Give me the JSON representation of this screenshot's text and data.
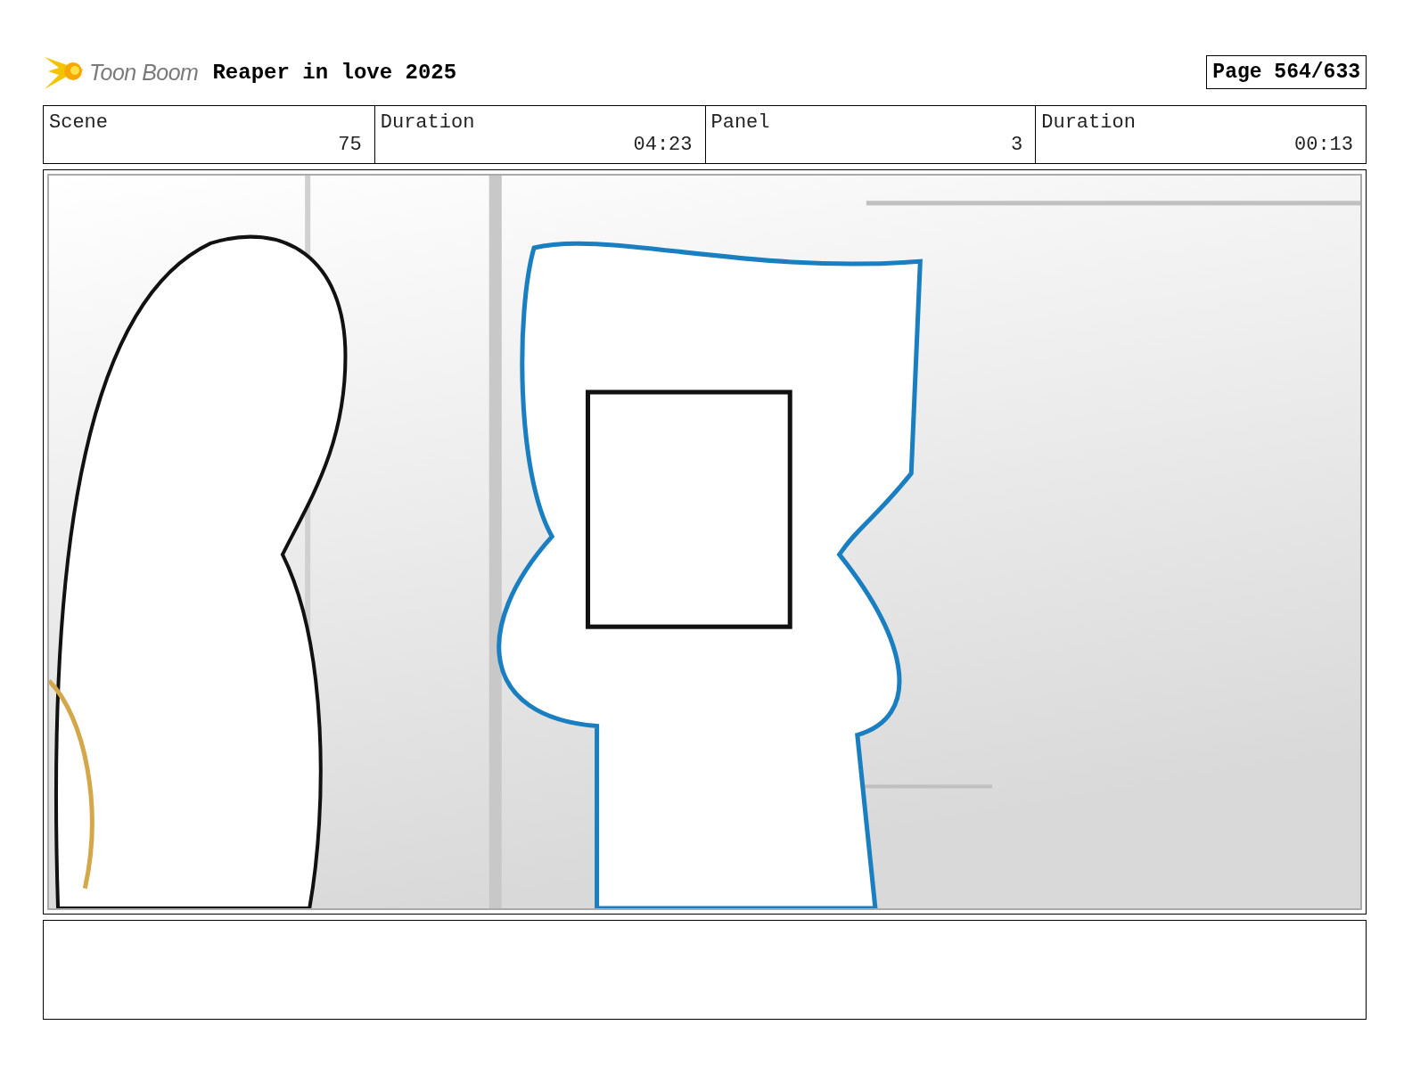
{
  "header": {
    "logo": "Toon Boom",
    "title": "Reaper in love 2025",
    "page": "Page 564/633"
  },
  "info": [
    {
      "label": "Scene",
      "value": "75"
    },
    {
      "label": "Duration",
      "value": "04:23"
    },
    {
      "label": "Panel",
      "value": "3"
    },
    {
      "label": "Duration",
      "value": "00:13"
    }
  ]
}
